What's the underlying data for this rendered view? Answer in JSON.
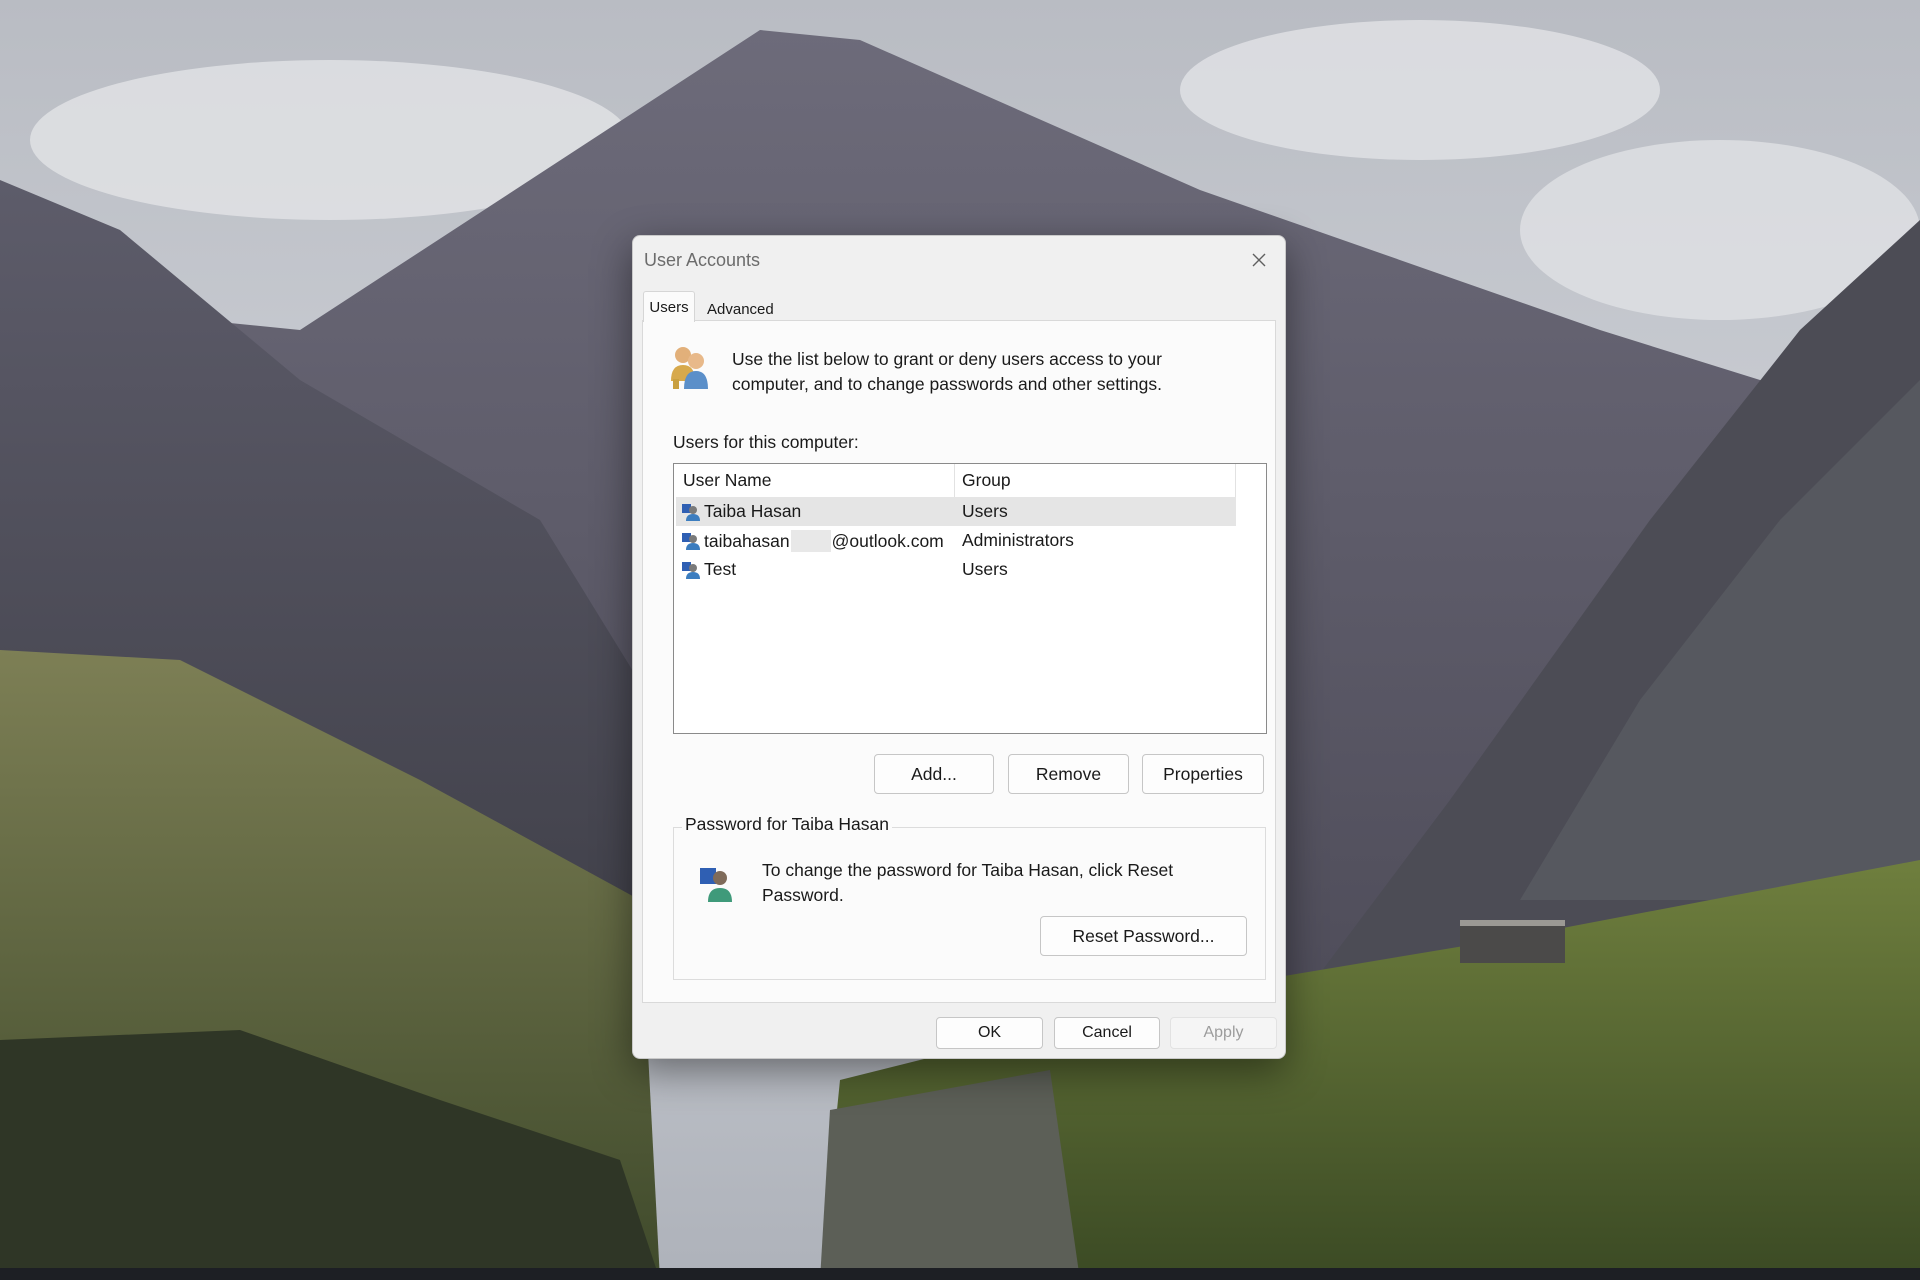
{
  "window": {
    "title": "User Accounts"
  },
  "tabs": [
    {
      "label": "Users"
    },
    {
      "label": "Advanced"
    }
  ],
  "intro": {
    "text": "Use the list below to grant or deny users access to your computer, and to change passwords and other settings."
  },
  "users_list": {
    "label": "Users for this computer:",
    "columns": [
      "User Name",
      "Group"
    ],
    "rows": [
      {
        "user_prefix": "Taiba Hasan",
        "user_suffix": "",
        "group": "Users"
      },
      {
        "user_prefix": "taibahasan",
        "user_suffix": "@outlook.com",
        "group": "Administrators"
      },
      {
        "user_prefix": "Test",
        "user_suffix": "",
        "group": "Users"
      }
    ]
  },
  "list_buttons": {
    "add": "Add...",
    "remove": "Remove",
    "properties": "Properties"
  },
  "password": {
    "legend": "Password for Taiba Hasan",
    "text": "To change the password for Taiba Hasan, click Reset Password.",
    "reset_button": "Reset Password..."
  },
  "footer": {
    "ok": "OK",
    "cancel": "Cancel",
    "apply": "Apply"
  },
  "colors": {
    "dialog_bg": "#f0f0f0",
    "panel_bg": "#fbfbfb",
    "selected_row": "#e5e5e5",
    "disabled_text": "#9c9c9c"
  }
}
